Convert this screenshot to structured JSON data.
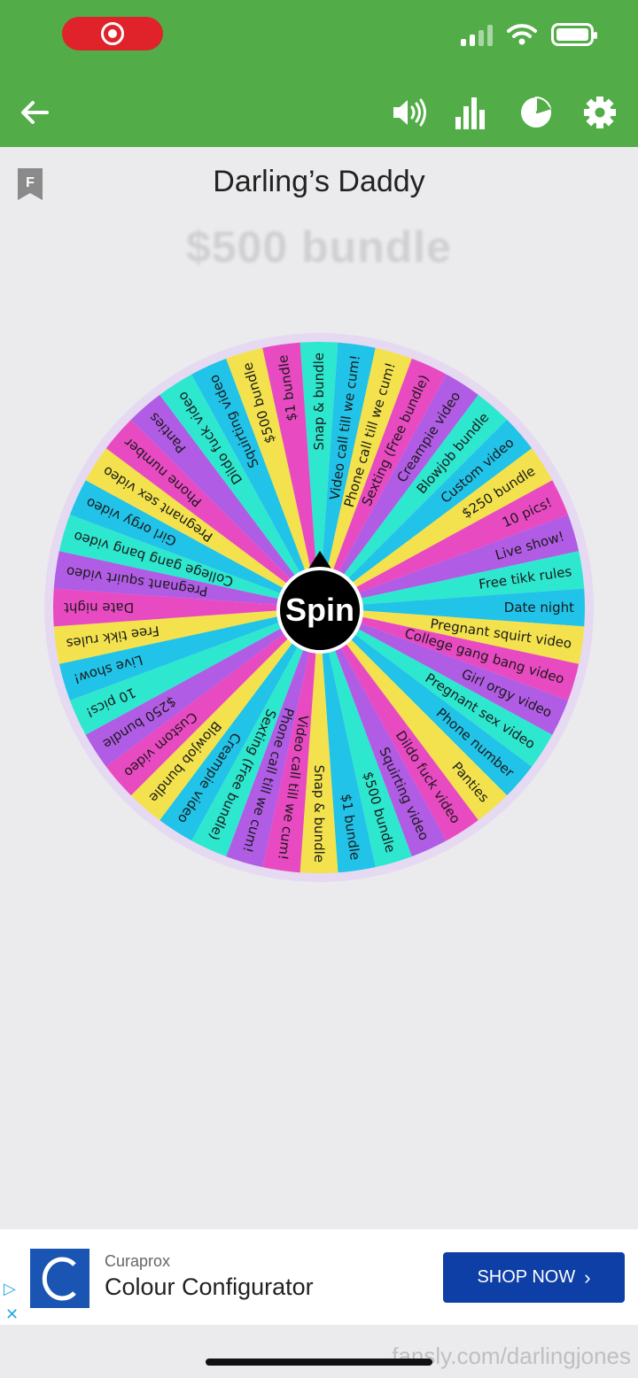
{
  "page": {
    "title": "Darling’s Daddy",
    "ghost_text": "$500 bundle"
  },
  "colors": {
    "header": "#52ad48",
    "background": "#ebebee",
    "ad_cta": "#0d3fa6",
    "ad_logo": "#1a55b3",
    "wheel_palette": [
      "#2ee7cf",
      "#21c3e8",
      "#f3e24d",
      "#e84ac2",
      "#b15ce4"
    ]
  },
  "toolbar": {
    "back": "arrow-left-icon",
    "sound": "speaker-icon",
    "stats": "bar-chart-icon",
    "results": "pie-chart-icon",
    "settings": "gear-icon"
  },
  "wheel": {
    "spin_label": "Spin",
    "segments": [
      "Snap & bundle",
      "Video call till we cum!",
      "Phone call till we cum!",
      "Sexting (Free bundle)",
      "Creampie video",
      "Blowjob bundle",
      "Custom video",
      "$250 bundle",
      "10 pics!",
      "Live show!",
      "Free tikk rules",
      "Date night",
      "Pregnant squirt video",
      "College gang bang video",
      "Girl orgy video",
      "Pregnant sex video",
      "Phone number",
      "Panties",
      "Dildo fuck video",
      "Squirting video",
      "$500 bundle",
      "$1 bundle"
    ]
  },
  "ad": {
    "brand": "Curaprox",
    "headline": "Colour Configurator",
    "cta": "SHOP NOW"
  },
  "watermark": "fansly.com/darlingjones"
}
